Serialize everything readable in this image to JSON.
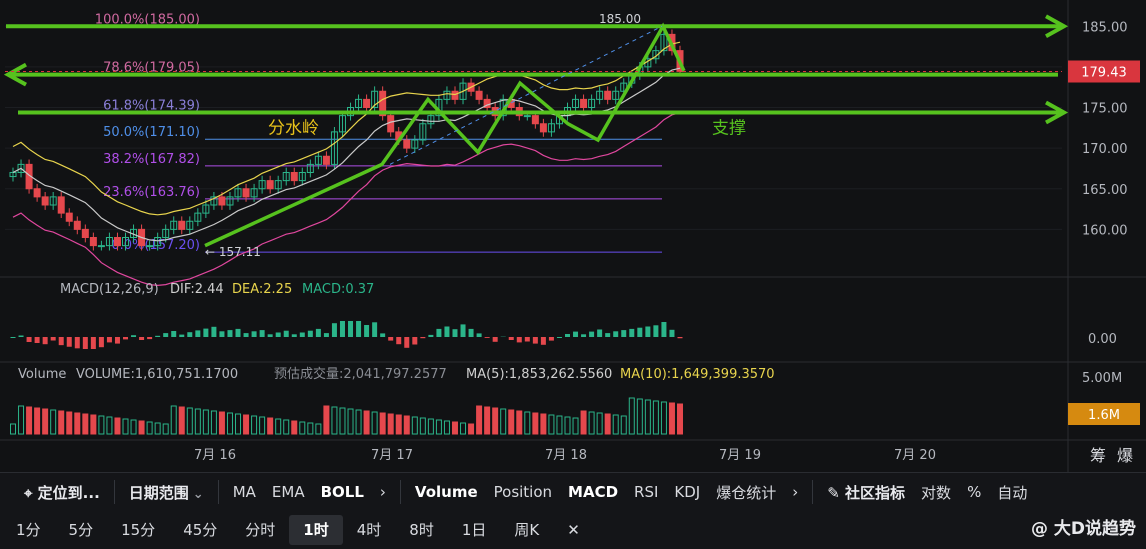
{
  "price_axis": {
    "ticks": [
      "185.00",
      "180.00",
      "175.00",
      "170.00",
      "165.00",
      "160.00"
    ],
    "current_price": "179.43",
    "current_color": "#d9363e"
  },
  "macd_panel": {
    "label": "MACD(12,26,9)",
    "dif": "DIF:2.44",
    "dea": "DEA:2.25",
    "macd": "MACD:0.37",
    "zero_tick": "0.00"
  },
  "volume_panel": {
    "label": "Volume",
    "volume": "VOLUME:1,610,751.1700",
    "estimated": "预估成交量:2,041,797.2577",
    "ma5": "MA(5):1,853,262.5560",
    "ma10": "MA(10):1,649,399.3570",
    "tick": "5.00M",
    "current": "1.6M",
    "current_color": "#d68a10"
  },
  "time_axis": {
    "labels": [
      "7月 16",
      "7月 17",
      "7月 18",
      "7月 19",
      "7月 20"
    ],
    "corner": [
      "筹",
      "爆"
    ]
  },
  "annotations": {
    "left_text": "分水岭",
    "right_text": "支撑",
    "high_label": "185.00",
    "low_label": "157.11",
    "arrow_color": "#56c21e"
  },
  "chart_data": {
    "type": "candlestick",
    "fib_levels": [
      {
        "label": "100.0%(185.00)",
        "value": 185.0,
        "color": "#d06aa0"
      },
      {
        "label": "78.6%(179.05)",
        "value": 179.05,
        "color": "#d06aa0"
      },
      {
        "label": "61.8%(174.39)",
        "value": 174.39,
        "color": "#8a7fd8"
      },
      {
        "label": "50.0%(171.10)",
        "value": 171.1,
        "color": "#4f8fe8"
      },
      {
        "label": "38.2%(167.82)",
        "value": 167.82,
        "color": "#b04fe8"
      },
      {
        "label": "23.6%(163.76)",
        "value": 163.76,
        "color": "#b04fe8"
      },
      {
        "label": "0.0%(157.20)",
        "value": 157.2,
        "color": "#6a4ff0"
      }
    ],
    "closes": [
      167,
      168,
      165,
      164,
      163,
      164,
      162,
      161,
      160,
      159,
      158,
      158,
      159,
      158,
      159,
      160,
      158,
      158,
      159,
      160,
      161,
      160,
      161,
      162,
      163,
      164,
      163,
      164,
      165,
      164,
      165,
      166,
      165,
      166,
      167,
      166,
      167,
      168,
      169,
      168,
      172,
      174,
      175,
      176,
      175,
      177,
      174,
      172,
      171,
      170,
      171,
      173,
      174,
      176,
      177,
      176,
      178,
      177,
      176,
      175,
      174,
      176,
      175,
      174,
      174,
      173,
      172,
      173,
      174,
      175,
      176,
      175,
      176,
      177,
      176,
      177,
      178,
      179,
      180,
      181,
      182,
      184,
      182,
      179.43
    ],
    "ylim": [
      155,
      187
    ],
    "x_labels": [
      "7月 16",
      "7月 17",
      "7月 18",
      "7月 19",
      "7月 20"
    ]
  },
  "toolbar": {
    "locate": "定位到...",
    "date_range": "日期范围",
    "indicators_main": [
      "MA",
      "EMA",
      "BOLL"
    ],
    "indicators_sub": [
      "Volume",
      "Position",
      "MACD",
      "RSI",
      "KDJ",
      "爆仓统计"
    ],
    "community": "社区指标",
    "right_items": [
      "对数",
      "%",
      "自动"
    ],
    "timeframes": [
      "1分",
      "5分",
      "15分",
      "45分",
      "分时",
      "1时",
      "4时",
      "8时",
      "1日",
      "周K"
    ],
    "selected_timeframe": "1时",
    "brand": "@ 大D说趋势"
  }
}
